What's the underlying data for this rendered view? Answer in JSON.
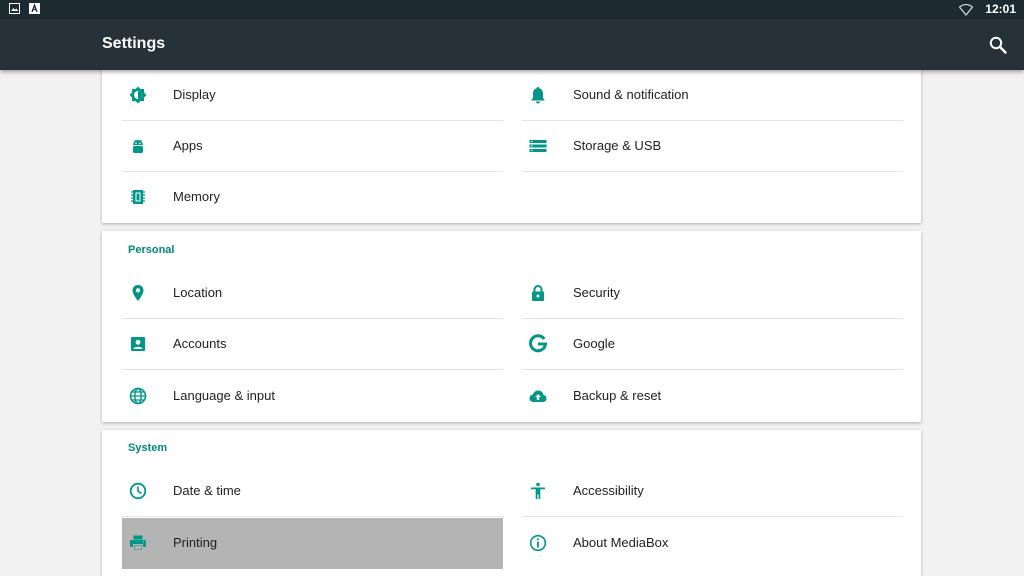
{
  "statusbar": {
    "time": "12:01"
  },
  "toolbar": {
    "title": "Settings"
  },
  "sections": {
    "device": {
      "display": "Display",
      "sound": "Sound & notification",
      "apps": "Apps",
      "storage": "Storage & USB",
      "memory": "Memory"
    },
    "personal": {
      "title": "Personal",
      "location": "Location",
      "security": "Security",
      "accounts": "Accounts",
      "google": "Google",
      "language": "Language & input",
      "backup": "Backup & reset"
    },
    "system": {
      "title": "System",
      "datetime": "Date & time",
      "accessibility": "Accessibility",
      "printing": "Printing",
      "about": "About MediaBox"
    }
  },
  "colors": {
    "accent": "#009688",
    "toolbar": "#263238",
    "statusbar": "#1d2a30",
    "selected": "#b4b4b4"
  }
}
